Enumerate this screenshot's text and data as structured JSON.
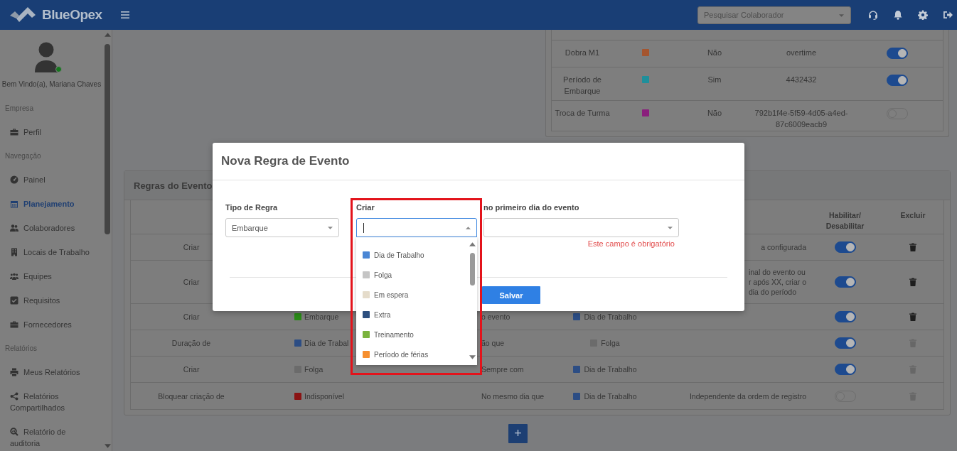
{
  "header": {
    "brand": "BlueOpex",
    "search": {
      "placeholder": "Pesquisar Colaborador"
    }
  },
  "sidebar": {
    "user": {
      "greeting": "Bem Vindo(a), Mariana Chaves",
      "online": true
    },
    "sections": [
      {
        "title": "Empresa",
        "items": [
          {
            "label": "Perfil",
            "selected": false
          }
        ]
      },
      {
        "title": "Navegação",
        "items": [
          {
            "label": "Painel",
            "selected": false
          },
          {
            "label": "Planejamento",
            "selected": true
          },
          {
            "label": "Colaboradores",
            "selected": false
          },
          {
            "label": "Locais de Trabalho",
            "selected": false
          },
          {
            "label": "Equipes",
            "selected": false
          },
          {
            "label": "Requisitos",
            "selected": false
          },
          {
            "label": "Fornecedores",
            "selected": false
          }
        ]
      },
      {
        "title": "Relatórios",
        "items": [
          {
            "label": "Meus Relatórios",
            "selected": false
          },
          {
            "label": "Relatórios Compartilhados",
            "selected": false
          },
          {
            "label": "Relatório de auditoria",
            "selected": false
          }
        ]
      }
    ]
  },
  "event_types": {
    "rows": [
      {
        "name": "Dobra M1",
        "color": "#a4552f",
        "flag": "Não",
        "code": "overtime",
        "enabled": true
      },
      {
        "name": "Período de Embarque",
        "color": "#1f8f9b",
        "flag": "Sim",
        "code": "4432432",
        "enabled": true
      },
      {
        "name": "Troca de Turma",
        "color": "#8a1f7c",
        "flag": "Não",
        "code": "792b1f4e-5f59-4d05-a4ed-87c6009eacb9",
        "enabled": false
      }
    ]
  },
  "rules": {
    "title": "Regras do Evento",
    "columns": [
      "Habilitar/ Desabilitar",
      "Excluir"
    ],
    "rows": [
      {
        "action": "Criar",
        "condition": "a configurada",
        "enabled": true,
        "can_delete": true
      },
      {
        "action": "Criar",
        "condition": "inal do evento ou\nr após XX, criar o\ndia do período",
        "enabled": true,
        "can_delete": true
      },
      {
        "action": "Criar",
        "event": {
          "name": "Embarque",
          "color": "#2a8a17"
        },
        "relation": "o evento",
        "target": {
          "name": "Dia de Trabalho",
          "color": "#2c4d84"
        },
        "enabled": true,
        "can_delete": true
      },
      {
        "action": "Duração de",
        "event": {
          "name": "Dia de Trabal",
          "color": "#2c4d84"
        },
        "relation": "ão que",
        "target": {
          "name": "Folga",
          "color": "#6b6b6b"
        },
        "enabled": true,
        "can_delete": false
      },
      {
        "action": "Criar",
        "event": {
          "name": "Folga",
          "color": "#6b6b6b"
        },
        "relation": "Sempre com",
        "target": {
          "name": "Dia de Trabalho",
          "color": "#2c4d84"
        },
        "enabled": true,
        "can_delete": false
      },
      {
        "action": "Bloquear criação de",
        "event": {
          "name": "Indisponível",
          "color": "#8a1313"
        },
        "relation": "No mesmo dia que",
        "target": {
          "name": "Dia de Trabalho",
          "color": "#2c4d84"
        },
        "condition": "Independente da ordem de registro",
        "enabled": false,
        "can_delete": false
      }
    ]
  },
  "add_button": "+",
  "modal": {
    "title": "Nova Regra de Evento",
    "fields": [
      {
        "label": "Tipo de Regra",
        "value": "Embarque",
        "open": false
      },
      {
        "label": "Criar",
        "open": true
      },
      {
        "label": "no primeiro dia do evento",
        "open": false,
        "error": "Este campo é obrigatório"
      }
    ],
    "dropdown": {
      "options": [
        {
          "label": "Dia de Trabalho",
          "color": "#4a86d4"
        },
        {
          "label": "Folga",
          "color": "#c5c5c5"
        },
        {
          "label": "Em espera",
          "color": "#e5dccb"
        },
        {
          "label": "Extra",
          "color": "#2d4f7f"
        },
        {
          "label": "Treinamento",
          "color": "#7bb33e"
        },
        {
          "label": "Período de férias",
          "color": "#f68f2f"
        }
      ]
    },
    "save_button": "Salvar"
  },
  "highlight_frame": true
}
